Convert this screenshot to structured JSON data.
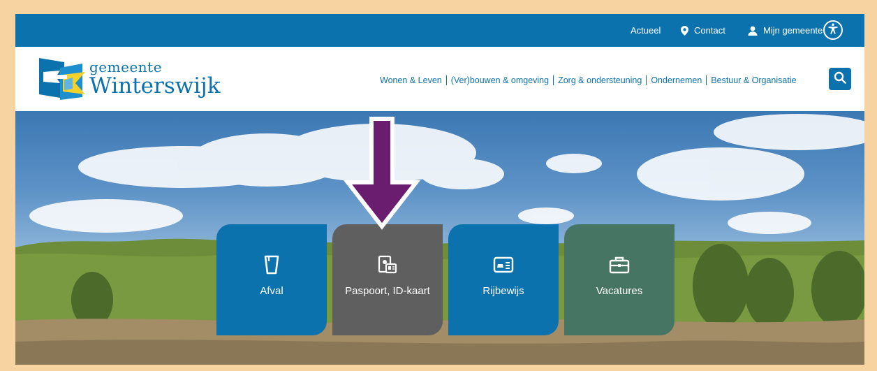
{
  "topbar": {
    "actueel_label": "Actueel",
    "contact_label": "Contact",
    "mijn_gemeente_label": "Mijn gemeente"
  },
  "header": {
    "logo_line1": "gemeente",
    "logo_line2": "Winterswijk",
    "nav": [
      {
        "label": "Wonen & Leven"
      },
      {
        "label": "(Ver)bouwen & omgeving"
      },
      {
        "label": "Zorg & ondersteuning"
      },
      {
        "label": "Ondernemen"
      },
      {
        "label": "Bestuur & Organisatie"
      }
    ]
  },
  "tiles": [
    {
      "label": "Afval",
      "icon": "waste-bin-icon",
      "color": "#0b72ad"
    },
    {
      "label": "Paspoort, ID-kaart",
      "icon": "passport-id-icon",
      "color": "#5f5f5f"
    },
    {
      "label": "Rijbewijs",
      "icon": "drivers-license-icon",
      "color": "#0b72ad"
    },
    {
      "label": "Vacatures",
      "icon": "briefcase-icon",
      "color": "#477563"
    }
  ],
  "colors": {
    "brand_blue": "#0b72ad",
    "frame": "#f6d3a1",
    "arrow_purple": "#6a1d6e",
    "tile_gray": "#5f5f5f",
    "tile_green": "#477563",
    "logo_yellow": "#f2d12a"
  }
}
